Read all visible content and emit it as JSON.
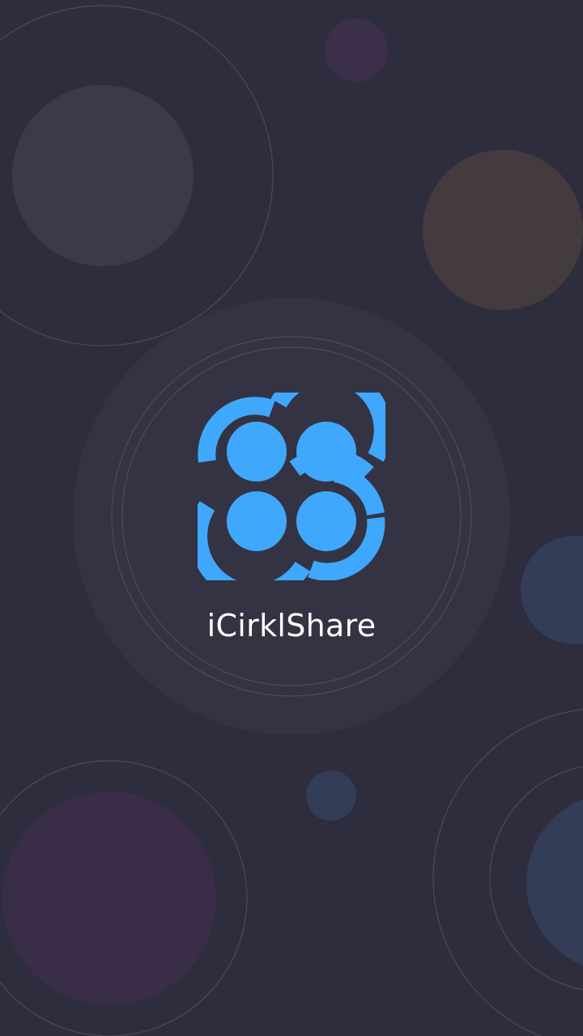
{
  "app": {
    "name": "iCirklShare"
  },
  "colors": {
    "background": "#2e2d3d",
    "brand": "#3fa8fc",
    "text": "#ffffff"
  },
  "icons": {
    "logo": "icirklshare-logo-icon"
  }
}
